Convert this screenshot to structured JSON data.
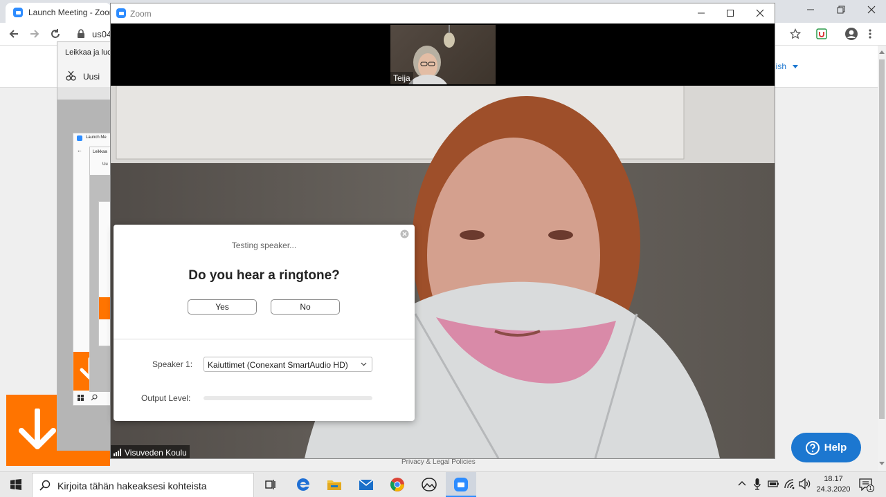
{
  "browser": {
    "tab_title": "Launch Meeting - Zoom",
    "address_partial": "us04",
    "lang_partial": "lish"
  },
  "snipping": {
    "title_partial": "Leikkaa ja luo",
    "new_label": "Uusi",
    "nested_tab": "Launch Me",
    "nested_title": "Leikkaa",
    "nested_new": "Uu"
  },
  "zoom": {
    "window_title": "Zoom",
    "thumb_name": "Teija",
    "main_name": "Visuveden Koulu"
  },
  "dialog": {
    "testing": "Testing speaker...",
    "question": "Do you hear a ringtone?",
    "yes": "Yes",
    "no": "No",
    "speaker_label": "Speaker 1:",
    "speaker_value": "Kaiuttimet (Conexant SmartAudio HD)",
    "output_label": "Output Level:",
    "output_level": 0
  },
  "footer": {
    "privacy": "Privacy & Legal Policies"
  },
  "help": {
    "label": "Help"
  },
  "taskbar": {
    "search_placeholder": "Kirjoita tähän hakeaksesi kohteista",
    "time": "18.17",
    "date": "24.3.2020",
    "notification_count": "1"
  },
  "colors": {
    "zoom_blue": "#2d8cff",
    "orange": "#ff7400",
    "help_blue": "#1c77d0"
  },
  "icons": [
    "zoom-icon",
    "back-arrow-icon",
    "forward-arrow-icon",
    "reload-icon",
    "lock-icon",
    "star-icon",
    "extension-icon",
    "profile-icon",
    "kebab-menu-icon",
    "minimize-icon",
    "maximize-icon",
    "close-icon",
    "restore-icon",
    "snip-icon",
    "signal-icon",
    "chevron-down-icon",
    "help-icon",
    "windows-icon",
    "search-icon",
    "task-view-icon",
    "edge-icon",
    "file-explorer-icon",
    "mail-icon",
    "chrome-icon",
    "photos-icon",
    "chevron-up-icon",
    "microphone-icon",
    "battery-icon",
    "wifi-icon",
    "speaker-icon",
    "notification-icon",
    "download-arrow-icon"
  ]
}
